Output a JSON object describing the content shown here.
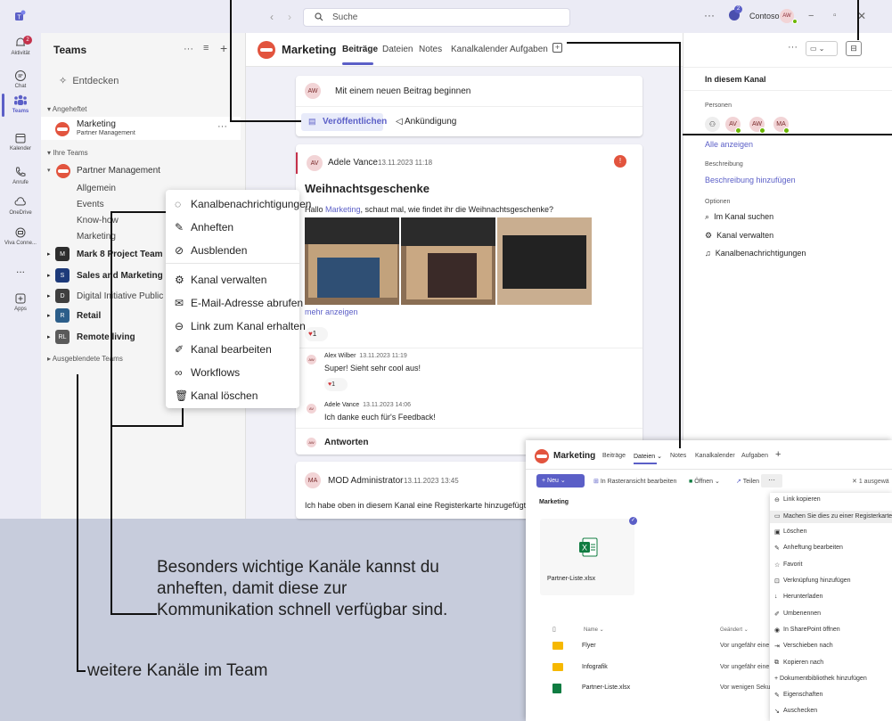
{
  "topbar": {
    "search_placeholder": "Suche",
    "org": "Contoso",
    "user_initials": "AW",
    "notif_count": "2"
  },
  "rail": [
    {
      "label": "Aktivität",
      "badge": "2",
      "icon": "bell-icon"
    },
    {
      "label": "Chat",
      "icon": "chat-icon"
    },
    {
      "label": "Teams",
      "icon": "teams-icon"
    },
    {
      "label": "Kalender",
      "icon": "calendar-icon"
    },
    {
      "label": "Anrufe",
      "icon": "phone-icon"
    },
    {
      "label": "OneDrive",
      "icon": "cloud-icon"
    },
    {
      "label": "Viva Conne...",
      "icon": "viva-icon"
    },
    {
      "label": "...",
      "icon": "more-icon"
    },
    {
      "label": "Apps",
      "icon": "apps-icon"
    }
  ],
  "teams_panel": {
    "title": "Teams",
    "discover": "Entdecken",
    "pinned_header": "Angeheftet",
    "pinned_channel": "Marketing",
    "pinned_sub": "Partner Management",
    "your_teams": "Ihre Teams",
    "partner_team": "Partner Management",
    "channels": [
      "Allgemein",
      "Events",
      "Know-how",
      "Marketing"
    ],
    "teams": [
      {
        "name": "Mark 8 Project Team",
        "color": "#2d2d2d",
        "initials": "M"
      },
      {
        "name": "Sales and Marketing",
        "color": "#1d3a7a",
        "initials": "S"
      },
      {
        "name": "Digital Initiative Public Rel",
        "color": "#3f3f3f",
        "initials": "D"
      },
      {
        "name": "Retail",
        "color": "#2c5e8a",
        "initials": "R"
      },
      {
        "name": "Remote living",
        "color": "#5a5a5a",
        "initials": "RL"
      }
    ],
    "hidden_teams": "Ausgeblendete Teams"
  },
  "context_menu": [
    {
      "label": "Kanalbenachrichtigungen",
      "icon": "bell-icon"
    },
    {
      "label": "Anheften",
      "icon": "pin-icon"
    },
    {
      "label": "Ausblenden",
      "icon": "hide-icon"
    },
    {
      "label": "Kanal verwalten",
      "icon": "gear-icon"
    },
    {
      "label": "E-Mail-Adresse abrufen",
      "icon": "mail-icon"
    },
    {
      "label": "Link zum Kanal erhalten",
      "icon": "link-icon"
    },
    {
      "label": "Kanal bearbeiten",
      "icon": "edit-icon"
    },
    {
      "label": "Workflows",
      "icon": "workflow-icon"
    },
    {
      "label": "Kanal löschen",
      "icon": "trash-icon"
    }
  ],
  "channel_header": {
    "name": "Marketing",
    "tabs": [
      "Beiträge",
      "Dateien",
      "Notes",
      "Kanalkalender",
      "Aufgaben"
    ]
  },
  "compose": {
    "avatar": "AW",
    "prompt": "Mit einem neuen Beitrag beginnen",
    "publish": "Veröffentlichen",
    "announce": "Ankündigung"
  },
  "post1": {
    "author": "Adele Vance",
    "initials": "AV",
    "time": "13.11.2023 11:18",
    "title": "Weihnachtsgeschenke",
    "body_prefix": "Hallo ",
    "mention": "Marketing",
    "body_suffix": ", schaut mal, wie findet ihr die Weihnachtsgeschenke?",
    "more": "mehr anzeigen",
    "reaction": "1",
    "reply1_author": "Alex Wilber",
    "reply1_time": "13.11.2023 11:19",
    "reply1_text": "Super! Sieht sehr cool aus!",
    "reply1_reaction": "1",
    "reply2_author": "Adele Vance",
    "reply2_time": "13.11.2023 14:06",
    "reply2_text": "Ich danke euch für's Feedback!",
    "reply_label": "Antworten"
  },
  "post2": {
    "author": "MOD Administrator",
    "initials": "MA",
    "time": "13.11.2023 13:45",
    "text": "Ich habe oben in diesem Kanal eine Registerkarte hinzugefügt."
  },
  "right_panel": {
    "title": "In diesem Kanal",
    "people_label": "Personen",
    "people": [
      "AV",
      "AW",
      "MA"
    ],
    "show_all": "Alle anzeigen",
    "desc_label": "Beschreibung",
    "desc_link": "Beschreibung hinzufügen",
    "options_label": "Optionen",
    "options": [
      "Im Kanal suchen",
      "Kanal verwalten",
      "Kanalbenachrichtigungen"
    ]
  },
  "sharepoint": {
    "channel": "Marketing",
    "tabs": [
      "Beiträge",
      "Dateien",
      "Notes",
      "Kanalkalender",
      "Aufgaben"
    ],
    "new": "Neu",
    "grid_edit": "In Rasteransicht bearbeiten",
    "open": "Öffnen",
    "share": "Teilen",
    "selected": "1 ausgewä",
    "breadcrumb": "Marketing",
    "tile_file": "Partner-Liste.xlsx",
    "col_name": "Name",
    "col_changed": "Geändert",
    "rows": [
      {
        "name": "Flyer",
        "changed": "Vor ungefähr eine"
      },
      {
        "name": "Infografik",
        "changed": "Vor ungefähr eine"
      },
      {
        "name": "Partner-Liste.xlsx",
        "changed": "Vor wenigen Seku"
      }
    ],
    "menu": [
      "Link kopieren",
      "Machen Sie dies zu einer Registerkarte",
      "Löschen",
      "Anheftung bearbeiten",
      "Favorit",
      "Verknüpfung hinzufügen",
      "Herunterladen",
      "Umbenennen",
      "In SharePoint öffnen",
      "Verschieben nach",
      "Kopieren nach",
      "+ Dokumentbibliothek hinzufügen",
      "Eigenschaften",
      "Auschecken"
    ]
  },
  "callouts": {
    "pin_text_1": "Besonders wichtige Kanäle kannst du",
    "pin_text_2": "anheften, damit diese zur",
    "pin_text_3": "Kommunikation schnell verfügbar sind.",
    "more_text": "weitere Kanäle im Team"
  },
  "colors": {
    "accent": "#5b5fc7",
    "red": "#c4314b",
    "green": "#6bb700",
    "callout_bg": "#c7ccdc"
  }
}
